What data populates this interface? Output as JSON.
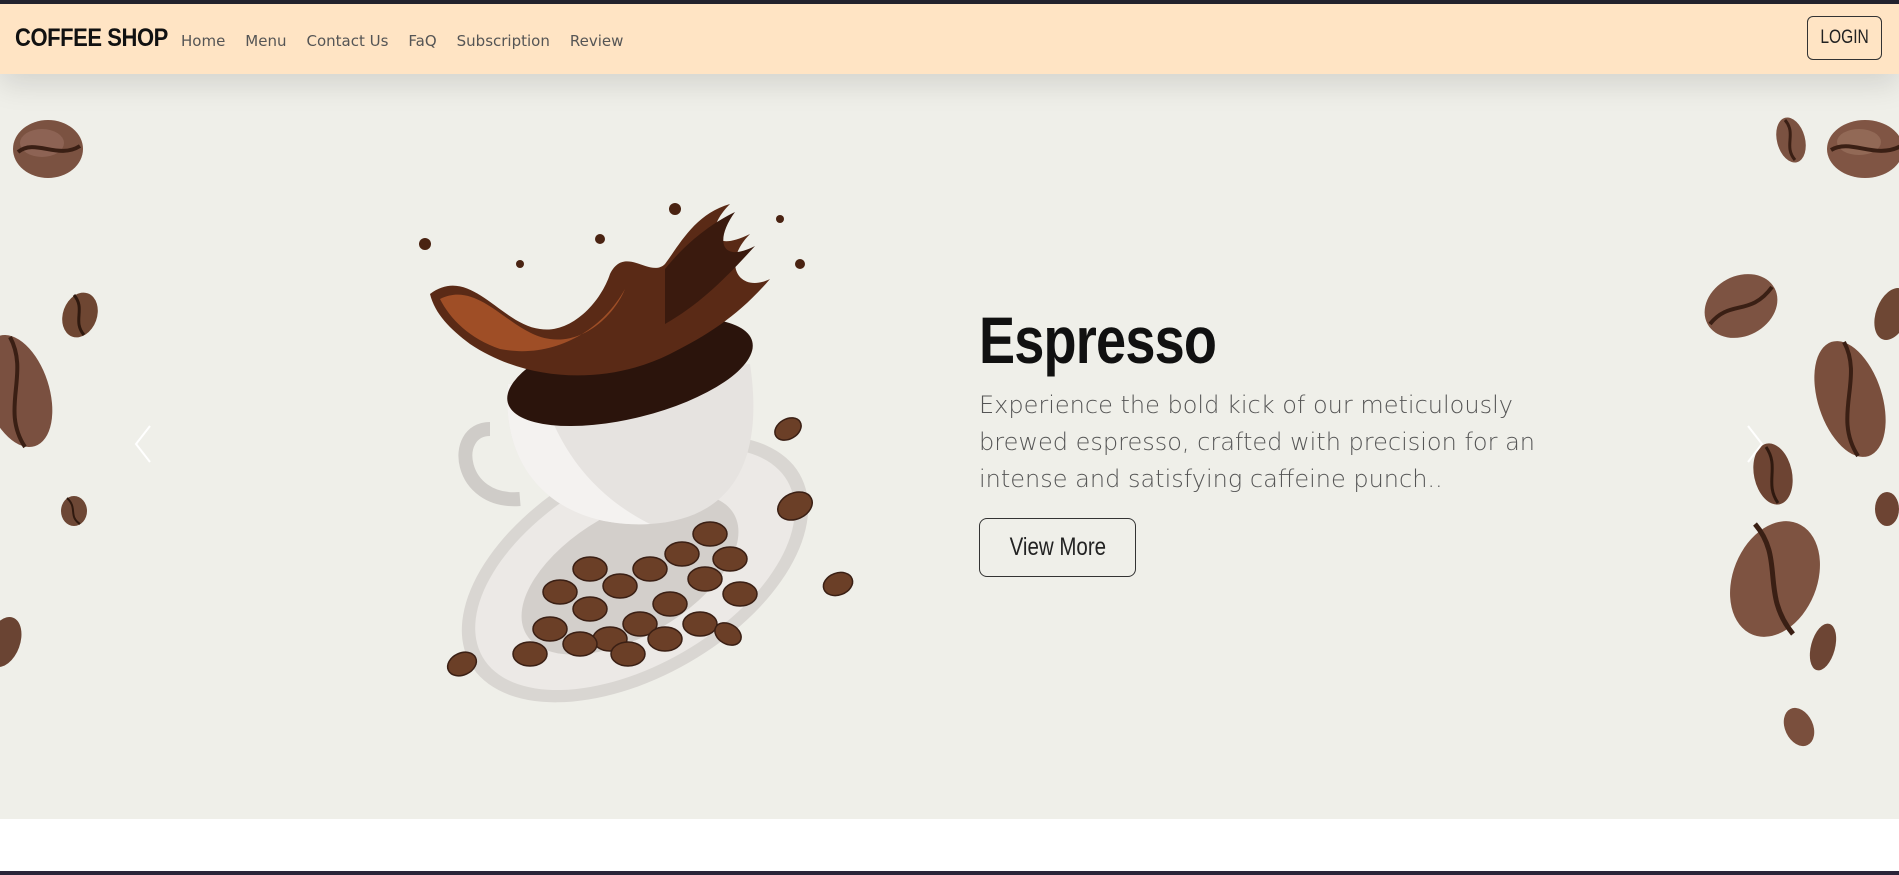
{
  "app": {
    "brand": "COFFEE SHOP",
    "accent_nav_bg": "#ffe4c4",
    "hero_bg": "#efefe9"
  },
  "nav": {
    "links": [
      {
        "label": "Home"
      },
      {
        "label": "Menu"
      },
      {
        "label": "Contact Us"
      },
      {
        "label": "FaQ"
      },
      {
        "label": "Subscription"
      },
      {
        "label": "Review"
      }
    ],
    "login_label": "LOGIN"
  },
  "hero": {
    "title": "Espresso",
    "description": "Experience the bold kick of our meticulously brewed espresso, crafted with precision for an intense and satisfying caffeine punch..",
    "cta_label": "View More",
    "prev_icon": "chevron-left-icon",
    "next_icon": "chevron-right-icon",
    "image_subject": "coffee-cup-splash-with-beans"
  }
}
